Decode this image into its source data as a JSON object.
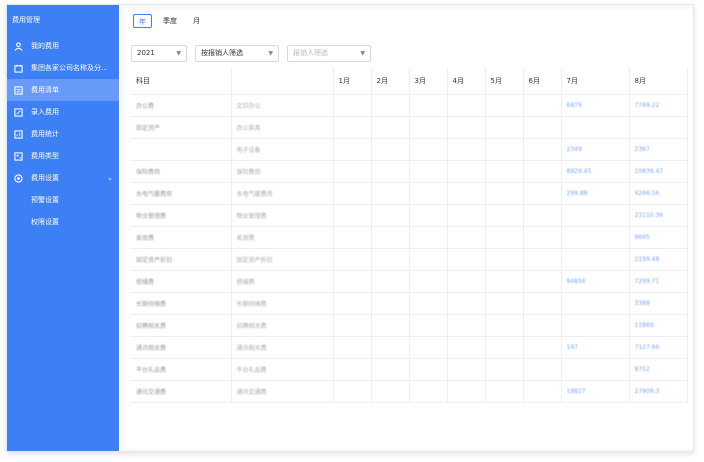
{
  "app": {
    "title": "费用管理"
  },
  "sidebar": {
    "items": [
      {
        "label": "我的费用",
        "icon": "user-icon"
      },
      {
        "label": "集团各家公司名称及分...",
        "icon": "calendar-icon"
      },
      {
        "label": "费用清单",
        "icon": "list-icon",
        "active": true
      },
      {
        "label": "录入费用",
        "icon": "edit-icon"
      },
      {
        "label": "费用统计",
        "icon": "stats-icon"
      },
      {
        "label": "费用类型",
        "icon": "type-icon"
      },
      {
        "label": "费用设置",
        "icon": "settings-icon",
        "expandable": true
      }
    ],
    "subitems": [
      "预警设置",
      "权限设置"
    ]
  },
  "tabs": [
    "年",
    "季度",
    "月"
  ],
  "active_tab": "年",
  "filters": {
    "year": "2021",
    "handler": "按报销人筛选",
    "reporter_placeholder": "报销人筛选"
  },
  "table": {
    "headers": [
      "科目",
      "",
      "1月",
      "2月",
      "3月",
      "4月",
      "5月",
      "6月",
      "7月",
      "8月"
    ],
    "rows": [
      {
        "c1": "办公费",
        "c2": "文印办公",
        "jul": "6879",
        "aug": "7769.22"
      },
      {
        "c1": "固定资产",
        "c2": "办公家具",
        "jul": "",
        "aug": ""
      },
      {
        "c1": "",
        "c2": "电子设备",
        "jul": "2349",
        "aug": "2367"
      },
      {
        "c1": "保险费用",
        "c2": "保险费用",
        "jul": "8929.45",
        "aug": "10839.47"
      },
      {
        "c1": "水电气暖费用",
        "c2": "水电气暖费用",
        "jul": "299.88",
        "aug": "4266.56"
      },
      {
        "c1": "物业管理费",
        "c2": "物业管理费",
        "jul": "",
        "aug": "23110.36"
      },
      {
        "c1": "差旅费",
        "c2": "差旅费",
        "jul": "",
        "aug": "9695"
      },
      {
        "c1": "固定资产折旧",
        "c2": "固定资产折旧",
        "jul": "",
        "aug": "2199.48"
      },
      {
        "c1": "修缮费",
        "c2": "修缮费",
        "jul": "94856",
        "aug": "7299.71"
      },
      {
        "c1": "长期待摊费",
        "c2": "长期待摊费",
        "jul": "",
        "aug": "3388"
      },
      {
        "c1": "招聘相关费",
        "c2": "招聘相关费",
        "jul": "",
        "aug": "11869"
      },
      {
        "c1": "通讯相关费",
        "c2": "通讯相关费",
        "jul": "197",
        "aug": "7127.66"
      },
      {
        "c1": "平台礼品费",
        "c2": "平台礼品费",
        "jul": "",
        "aug": "8752"
      },
      {
        "c1": "通讯交通费",
        "c2": "通讯交通费",
        "jul": "18827",
        "aug": "27909.3"
      }
    ]
  }
}
